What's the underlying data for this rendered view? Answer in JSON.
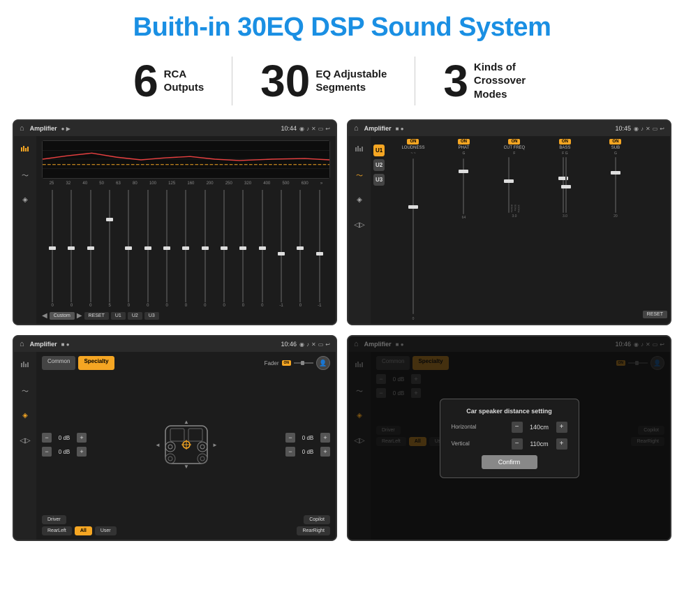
{
  "page": {
    "title": "Buith-in 30EQ DSP Sound System",
    "stats": [
      {
        "number": "6",
        "text": "RCA\nOutputs"
      },
      {
        "number": "30",
        "text": "EQ Adjustable\nSegments"
      },
      {
        "number": "3",
        "text": "Kinds of\nCrossover Modes"
      }
    ]
  },
  "screen_tl": {
    "title": "Amplifier",
    "time": "10:44",
    "eq_labels": [
      "25",
      "32",
      "40",
      "50",
      "63",
      "80",
      "100",
      "125",
      "160",
      "200",
      "250",
      "320",
      "400",
      "500",
      "630"
    ],
    "eq_values": [
      0,
      0,
      0,
      5,
      0,
      0,
      0,
      0,
      0,
      0,
      0,
      0,
      -1,
      0,
      -1
    ],
    "footer_btns": [
      "Custom",
      "RESET",
      "U1",
      "U2",
      "U3"
    ]
  },
  "screen_tr": {
    "title": "Amplifier",
    "time": "10:45",
    "presets": [
      "U1",
      "U2",
      "U3"
    ],
    "channels": [
      {
        "on": true,
        "name": "LOUDNESS"
      },
      {
        "on": true,
        "name": "PHAT"
      },
      {
        "on": true,
        "name": "CUT FREQ"
      },
      {
        "on": true,
        "name": "BASS"
      },
      {
        "on": true,
        "name": "SUB"
      }
    ],
    "reset_label": "RESET"
  },
  "screen_bl": {
    "title": "Amplifier",
    "time": "10:46",
    "tabs": [
      "Common",
      "Specialty"
    ],
    "active_tab": "Specialty",
    "fader_label": "Fader",
    "fader_on": true,
    "volumes": [
      {
        "val": "0 dB"
      },
      {
        "val": "0 dB"
      },
      {
        "val": "0 dB"
      },
      {
        "val": "0 dB"
      }
    ],
    "buttons": [
      "Driver",
      "Copilot",
      "RearLeft",
      "All",
      "User",
      "RearRight"
    ]
  },
  "screen_br": {
    "title": "Amplifier",
    "time": "10:46",
    "tabs": [
      "Common",
      "Specialty"
    ],
    "dialog": {
      "title": "Car speaker distance setting",
      "horizontal_label": "Horizontal",
      "horizontal_val": "140cm",
      "vertical_label": "Vertical",
      "vertical_val": "110cm",
      "confirm_label": "Confirm"
    },
    "buttons": [
      "Driver",
      "Copilot",
      "RearLeft",
      "All",
      "User",
      "RearRight"
    ]
  },
  "icons": {
    "home": "⌂",
    "back": "↩",
    "settings": "⚙",
    "volume": "♪",
    "speaker": "◈",
    "location": "◉",
    "camera": "⬡",
    "screen": "▭"
  }
}
